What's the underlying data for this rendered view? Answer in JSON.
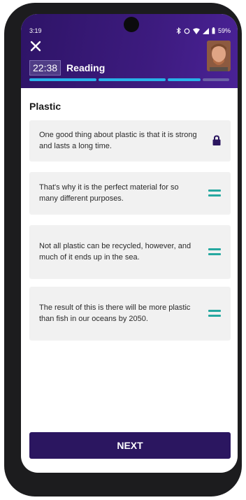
{
  "status_bar": {
    "time": "3:19",
    "battery": "59%"
  },
  "header": {
    "timer": "22:38",
    "mode_label": "Reading"
  },
  "content": {
    "title": "Plastic",
    "cards": [
      {
        "text": "One good thing about plastic is that it is strong and lasts a long time.",
        "icon": "lock-icon"
      },
      {
        "text": "That's why it is the perfect material for so many different purposes.",
        "icon": "drag-handle-icon"
      },
      {
        "text": "Not all plastic can be recycled, however, and much of it ends up in the sea.",
        "icon": "drag-handle-icon"
      },
      {
        "text": "The result of this is there will be more plastic than fish in our oceans by 2050.",
        "icon": "drag-handle-icon"
      }
    ]
  },
  "footer": {
    "next_label": "NEXT"
  },
  "colors": {
    "header": "#3d1b7f",
    "progress": "#27b2e8",
    "handle": "#26a8a0",
    "button": "#2b1660"
  }
}
